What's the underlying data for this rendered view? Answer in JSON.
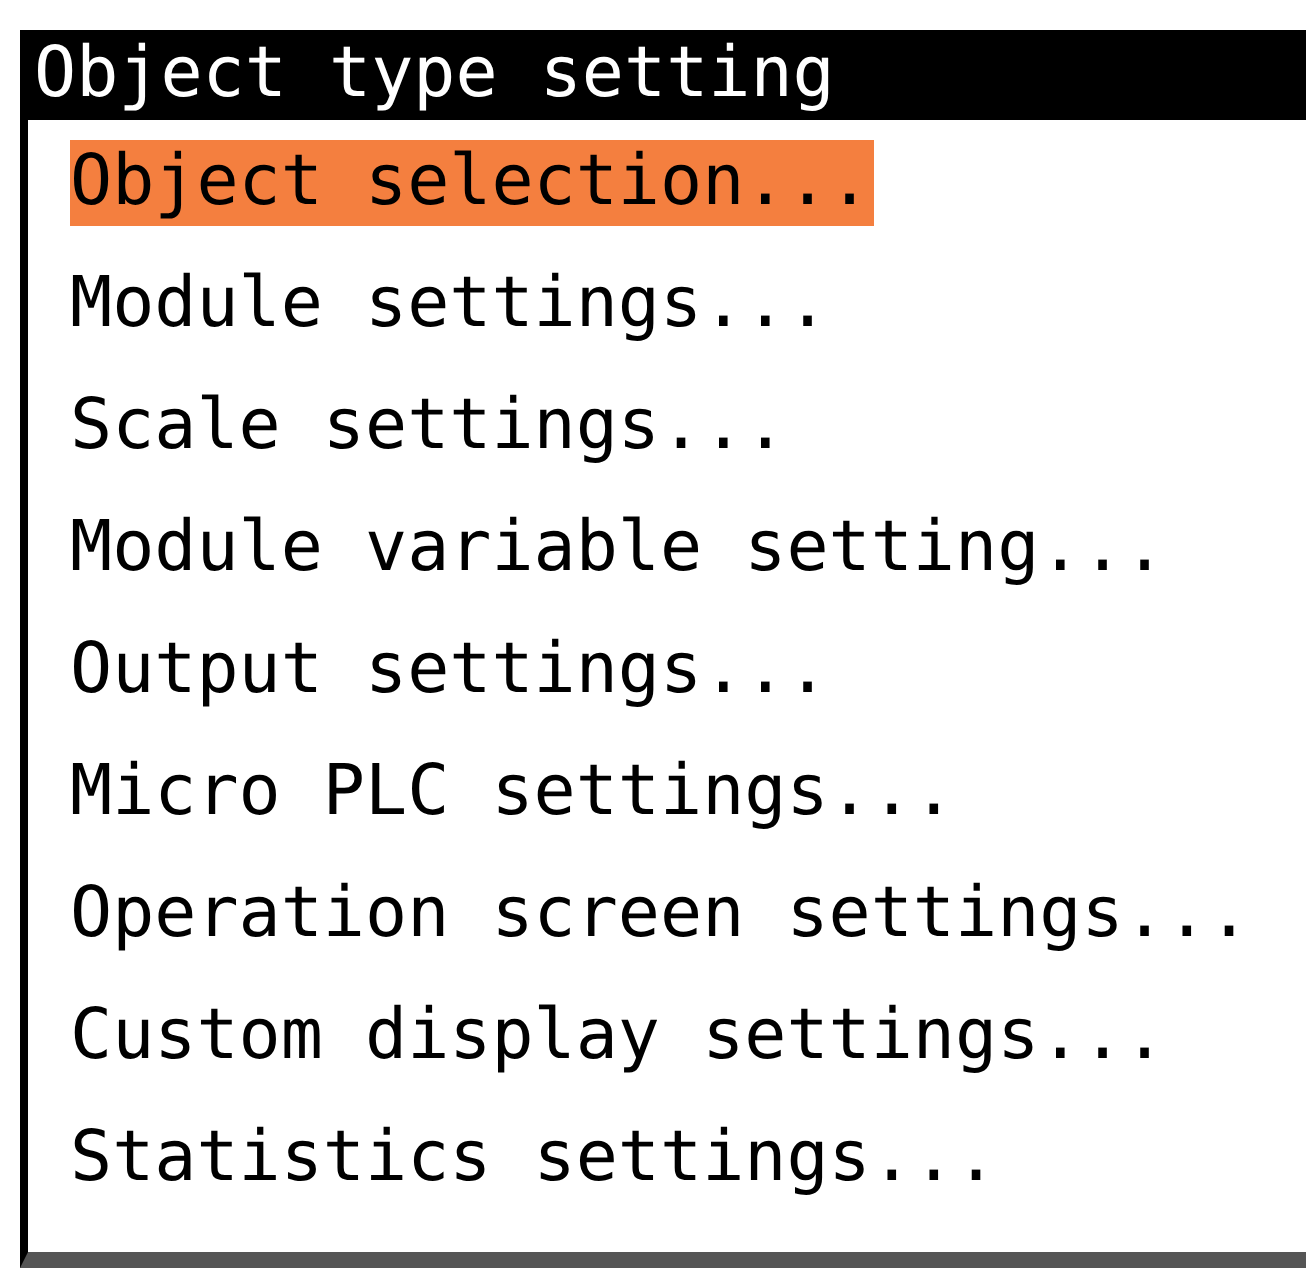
{
  "menu": {
    "title": "Object type setting",
    "items": [
      {
        "label": "Object selection...",
        "selected": true
      },
      {
        "label": "Module settings...",
        "selected": false
      },
      {
        "label": "Scale settings...",
        "selected": false
      },
      {
        "label": "Module variable setting...",
        "selected": false
      },
      {
        "label": "Output settings...",
        "selected": false
      },
      {
        "label": "Micro PLC settings...",
        "selected": false
      },
      {
        "label": "Operation screen settings...",
        "selected": false
      },
      {
        "label": "Custom display settings...",
        "selected": false
      },
      {
        "label": "Statistics settings...",
        "selected": false
      }
    ]
  }
}
